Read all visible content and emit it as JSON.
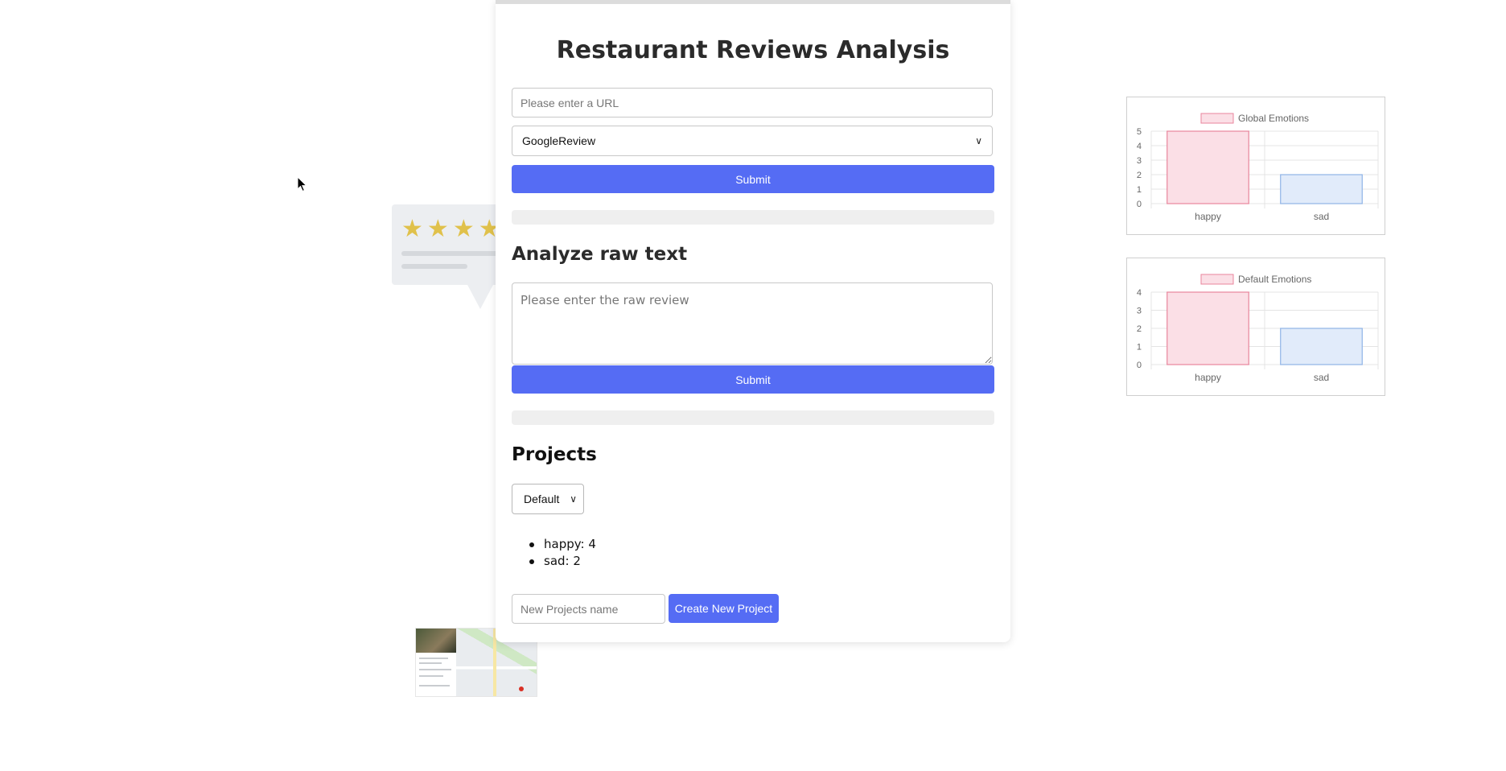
{
  "page": {
    "title": "Restaurant Reviews Analysis"
  },
  "url_form": {
    "url_placeholder": "Please enter a URL",
    "source_selected": "GoogleReview",
    "submit_label": "Submit",
    "progress": 0
  },
  "raw_form": {
    "heading": "Analyze raw text",
    "text_placeholder": "Please enter the raw review",
    "submit_label": "Submit",
    "progress": 0
  },
  "projects": {
    "heading": "Projects",
    "selected": "Default",
    "stats": [
      {
        "text": "happy: 4"
      },
      {
        "text": "sad: 2"
      }
    ],
    "new_name_placeholder": "New Projects name",
    "create_label": "Create New Project"
  },
  "decor": {
    "stars": [
      "★",
      "★",
      "★",
      "★"
    ],
    "star_color": "#e0c14b"
  },
  "colors": {
    "accent": "#556cf4",
    "series_happy_fill": "#fbdfe6",
    "series_happy_stroke": "#e8859c",
    "series_sad_fill": "#e1ebfa",
    "series_sad_stroke": "#8fb3e6"
  },
  "chart_data": [
    {
      "type": "bar",
      "legend": "Global Emotions",
      "categories": [
        "happy",
        "sad"
      ],
      "values": [
        5,
        2
      ],
      "ylim": [
        0,
        5
      ],
      "yticks": [
        "0",
        "1",
        "2",
        "3",
        "4",
        "5"
      ],
      "grid": true,
      "legend_position": "top"
    },
    {
      "type": "bar",
      "legend": "Default Emotions",
      "categories": [
        "happy",
        "sad"
      ],
      "values": [
        4,
        2
      ],
      "ylim": [
        0,
        4
      ],
      "yticks": [
        "0",
        "1",
        "2",
        "3",
        "4"
      ],
      "grid": true,
      "legend_position": "top"
    }
  ]
}
